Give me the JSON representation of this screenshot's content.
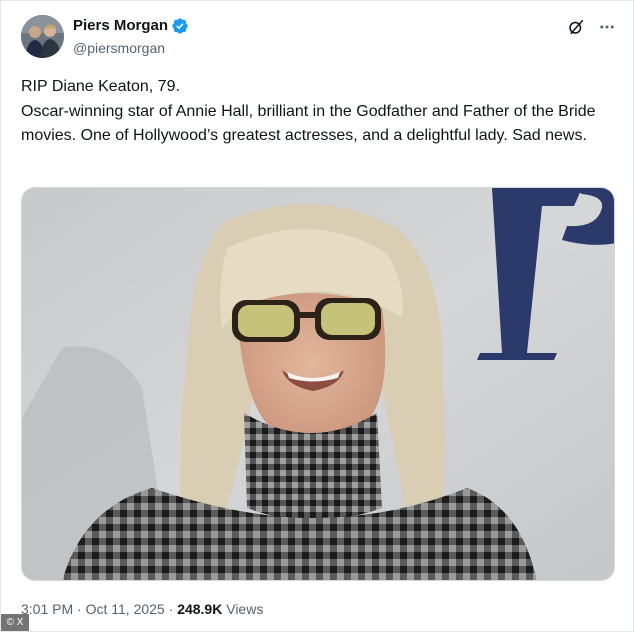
{
  "author": {
    "display_name": "Piers Morgan",
    "handle": "@piersmorgan",
    "verified": true,
    "verified_color": "#1d9bf0",
    "avatar_icon": "avatar-photo"
  },
  "header_actions": {
    "grok_icon": "grok-icon",
    "more_icon": "more-icon"
  },
  "tweet": {
    "line_1": "RIP Diane Keaton, 79.",
    "line_2": "Oscar-winning star of Annie Hall, brilliant in the Godfather and Father of the Bride movies. One of Hollywood’s greatest actresses, and a delightful lady. Sad news."
  },
  "media": {
    "type": "photo",
    "backdrop_letter": "P"
  },
  "meta": {
    "time": "3:01 PM",
    "separator_1": "·",
    "date": "Oct 11, 2025",
    "separator_2": "·",
    "views_count": "248.9K",
    "views_label": "Views"
  },
  "credit": {
    "text": "© X"
  },
  "colors": {
    "text_primary": "#0f1419",
    "text_secondary": "#536471",
    "border": "#cfd9de"
  }
}
